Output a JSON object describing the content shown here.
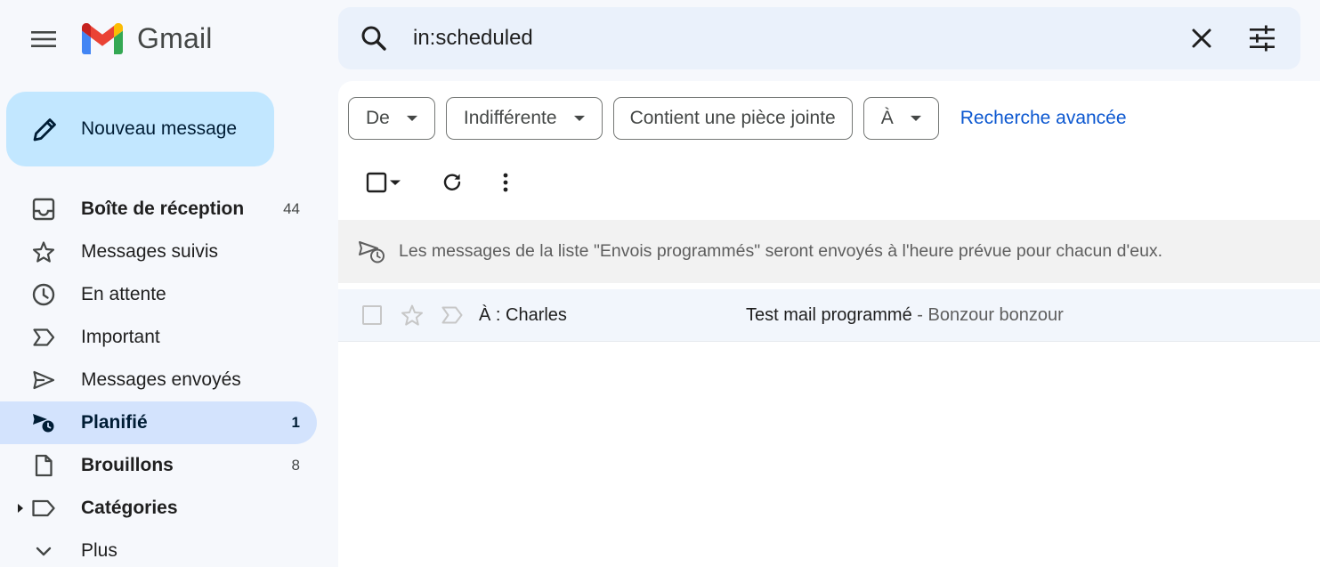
{
  "app": {
    "name": "Gmail"
  },
  "search": {
    "value": "in:scheduled"
  },
  "compose": {
    "label": "Nouveau message"
  },
  "nav": [
    {
      "label": "Boîte de réception",
      "count": "44",
      "icon": "inbox-icon"
    },
    {
      "label": "Messages suivis",
      "count": "",
      "icon": "star-icon"
    },
    {
      "label": "En attente",
      "count": "",
      "icon": "clock-icon"
    },
    {
      "label": "Important",
      "count": "",
      "icon": "important-icon"
    },
    {
      "label": "Messages envoyés",
      "count": "",
      "icon": "send-icon"
    },
    {
      "label": "Planifié",
      "count": "1",
      "icon": "scheduled-send-icon"
    },
    {
      "label": "Brouillons",
      "count": "8",
      "icon": "draft-icon"
    },
    {
      "label": "Catégories",
      "count": "",
      "icon": "label-icon"
    },
    {
      "label": "Plus",
      "count": "",
      "icon": "chevron-down-icon"
    }
  ],
  "filters": {
    "from": "De",
    "date": "Indifférente",
    "attachment": "Contient une pièce jointe",
    "to": "À",
    "advanced": "Recherche avancée"
  },
  "banner": {
    "text": "Les messages de la liste \"Envois programmés\" seront envoyés à l'heure prévue pour chacun d'eux."
  },
  "messages": [
    {
      "sender": "À : Charles",
      "subject": "Test mail programmé",
      "snippet": " - Bonzour bonzour"
    }
  ],
  "colors": {
    "page_bg": "#f6f8fc",
    "compose_bg": "#c2e7ff",
    "active_nav_bg": "#d3e3fd",
    "search_bg": "#eaf1fb",
    "link": "#0b57d0"
  }
}
